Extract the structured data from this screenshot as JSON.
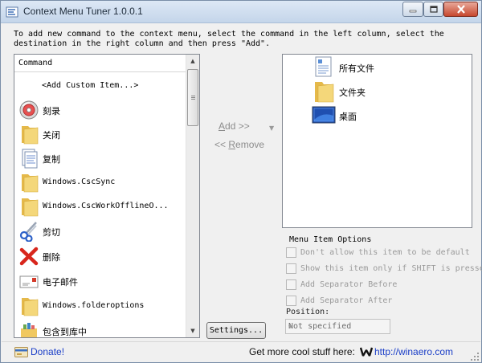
{
  "window": {
    "title": "Context Menu Tuner 1.0.0.1"
  },
  "instructions": "To add new command to the context menu, select the command in the left column, select the destination in the right column and then press \"Add\".",
  "commands": {
    "header": "Command",
    "items": [
      {
        "label": "<Add Custom Item...>",
        "icon": "none"
      },
      {
        "label": "刻录",
        "icon": "burn-disc-icon"
      },
      {
        "label": "关闭",
        "icon": "folder-icon"
      },
      {
        "label": "复制",
        "icon": "copy-document-icon"
      },
      {
        "label": "Windows.CscSync",
        "icon": "folder-icon"
      },
      {
        "label": "Windows.CscWorkOfflineO...",
        "icon": "folder-icon"
      },
      {
        "label": "剪切",
        "icon": "scissors-icon"
      },
      {
        "label": "删除",
        "icon": "delete-x-icon"
      },
      {
        "label": "电子邮件",
        "icon": "envelope-icon"
      },
      {
        "label": "Windows.folderoptions",
        "icon": "folder-icon"
      },
      {
        "label": "包含到库中",
        "icon": "library-icon"
      }
    ]
  },
  "actions": {
    "add": "Add >>",
    "add_key": "A",
    "remove": "<< Remove",
    "remove_key": "R"
  },
  "destinations": [
    {
      "label": "所有文件",
      "icon": "document-icon"
    },
    {
      "label": "文件夹",
      "icon": "folder-icon"
    },
    {
      "label": "桌面",
      "icon": "desktop-icon"
    }
  ],
  "options": {
    "title": "Menu Item Options",
    "checkboxes": [
      {
        "label": "Don't allow this item to be default",
        "checked": false
      },
      {
        "label": "Show this item only if SHIFT is presse",
        "checked": false
      },
      {
        "label": "Add Separator Before",
        "checked": false
      },
      {
        "label": "Add Separator After",
        "checked": false
      }
    ],
    "position_label": "Position:",
    "position_value": "Not specified"
  },
  "settings_button": "Settings...",
  "statusbar": {
    "donate": "Donate!",
    "more": "Get more cool stuff here:",
    "link": "http://winaero.com"
  },
  "colors": {
    "link": "#1d40c8",
    "titlebar": "#c4d5ea",
    "close": "#c7472e"
  }
}
